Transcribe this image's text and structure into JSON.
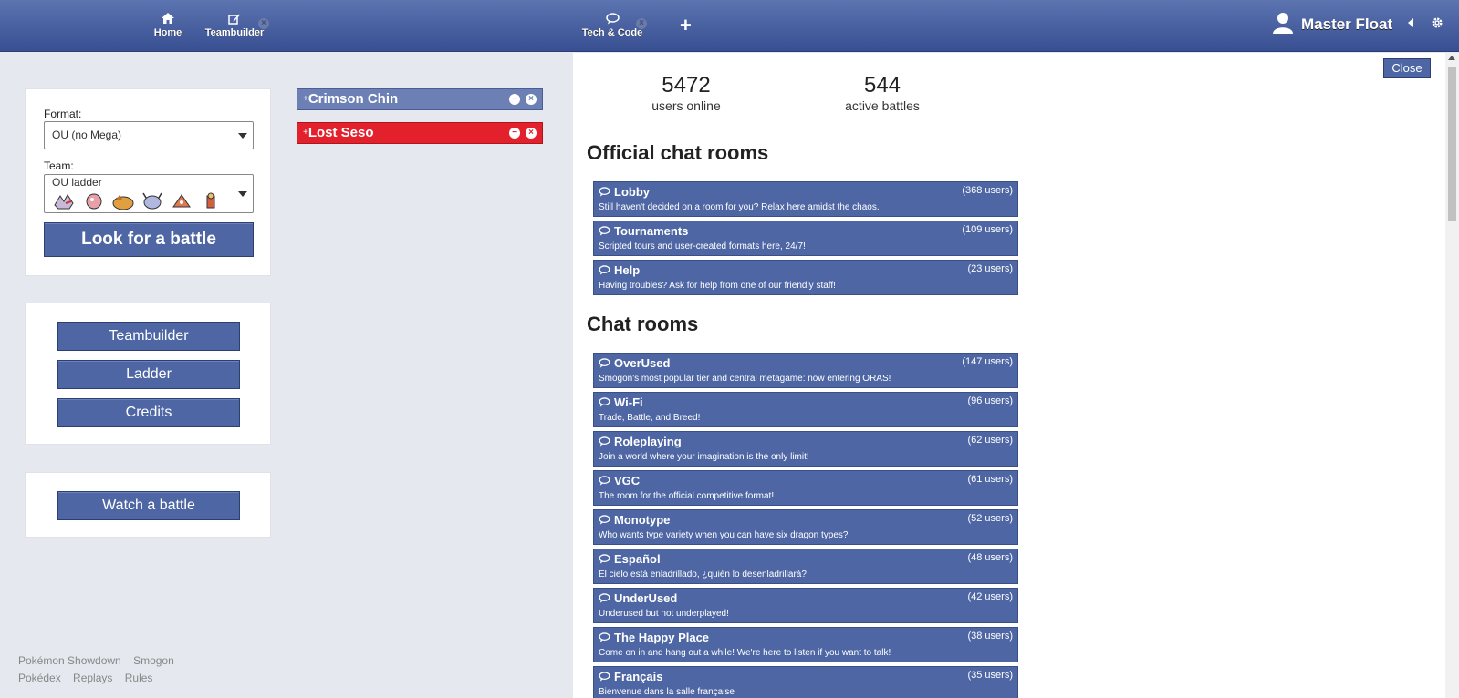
{
  "header": {
    "tabs": [
      {
        "label": "Home"
      },
      {
        "label": "Teambuilder"
      },
      {
        "label": "Tech & Code"
      }
    ],
    "plus": "+",
    "user_name": "Master Float"
  },
  "search_panel": {
    "format_label": "Format:",
    "format_value": "OU (no Mega)",
    "team_label": "Team:",
    "team_value": "OU ladder",
    "look_button": "Look for a battle"
  },
  "menu": {
    "teambuilder": "Teambuilder",
    "ladder": "Ladder",
    "credits": "Credits",
    "watch": "Watch a battle"
  },
  "footer": {
    "line1": [
      "Pokémon Showdown",
      "Smogon"
    ],
    "line2": [
      "Pokédex",
      "Replays",
      "Rules"
    ]
  },
  "challenges": [
    {
      "prefix": "+",
      "name": "Crimson Chin"
    },
    {
      "prefix": "+",
      "name": "Lost Seso"
    }
  ],
  "room_pane": {
    "close": "Close",
    "users_online": "5472",
    "users_online_label": "users online",
    "active_battles": "544",
    "active_battles_label": "active battles",
    "official_title": "Official chat rooms",
    "chat_title": "Chat rooms",
    "official_rooms": [
      {
        "name": "Lobby",
        "count": "(368 users)",
        "desc": "Still haven't decided on a room for you? Relax here amidst the chaos."
      },
      {
        "name": "Tournaments",
        "count": "(109 users)",
        "desc": "Scripted tours and user-created formats here, 24/7!"
      },
      {
        "name": "Help",
        "count": "(23 users)",
        "desc": "Having troubles? Ask for help from one of our friendly staff!"
      }
    ],
    "chat_rooms": [
      {
        "name": "OverUsed",
        "count": "(147 users)",
        "desc": "Smogon's most popular tier and central metagame: now entering ORAS!"
      },
      {
        "name": "Wi-Fi",
        "count": "(96 users)",
        "desc": "Trade, Battle, and Breed!"
      },
      {
        "name": "Roleplaying",
        "count": "(62 users)",
        "desc": "Join a world where your imagination is the only limit!"
      },
      {
        "name": "VGC",
        "count": "(61 users)",
        "desc": "The room for the official competitive format!"
      },
      {
        "name": "Monotype",
        "count": "(52 users)",
        "desc": "Who wants type variety when you can have six dragon types?"
      },
      {
        "name": "Español",
        "count": "(48 users)",
        "desc": "El cielo está enladrillado, ¿quién lo desenladrillará?"
      },
      {
        "name": "UnderUsed",
        "count": "(42 users)",
        "desc": "Underused but not underplayed!"
      },
      {
        "name": "The Happy Place",
        "count": "(38 users)",
        "desc": "Come on in and hang out a while! We're here to listen if you want to talk!"
      },
      {
        "name": "Français",
        "count": "(35 users)",
        "desc": "Bienvenue dans la salle française"
      }
    ]
  },
  "colors": {
    "header": "#384f92",
    "button": "#4e67a4",
    "challenge_neutral": "#6c80b5",
    "challenge_red": "#e3212c"
  },
  "icons": {
    "home": "home-icon",
    "teambuilder": "pencil-icon",
    "chat": "chat-bubble-icon",
    "user": "user-icon",
    "sound": "sound-icon",
    "settings": "gear-icon"
  }
}
